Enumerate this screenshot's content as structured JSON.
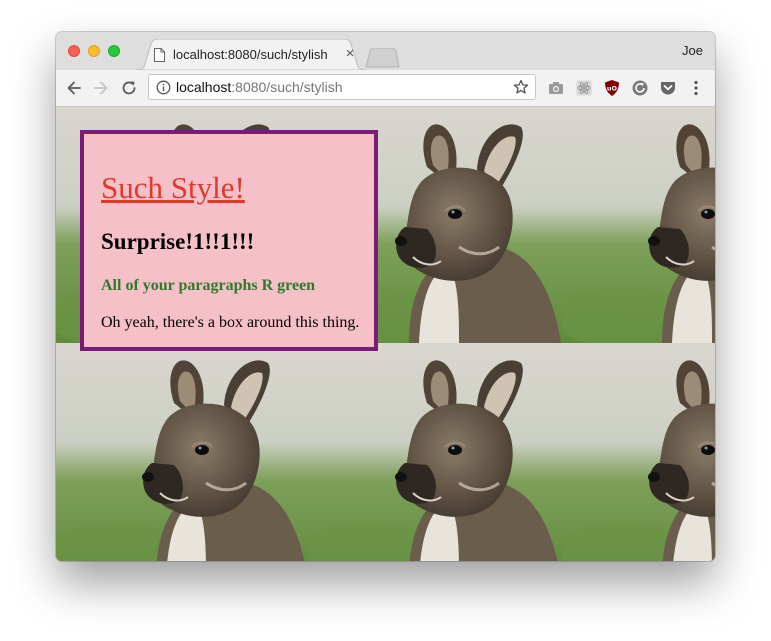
{
  "browser": {
    "tab": {
      "title": "localhost:8080/such/stylish"
    },
    "profile_name": "Joe",
    "omnibox": {
      "host": "localhost",
      "path": ":8080/such/stylish"
    }
  },
  "page": {
    "heading": "Such Style!",
    "subheading": "Surprise!1!!1!!!",
    "green_paragraph": "All of your paragraphs R green",
    "plain_paragraph": "Oh yeah, there's a box around this thing.",
    "colors": {
      "box_background": "#f6c0c9",
      "box_border": "#7b1a78",
      "heading": "#e0392b",
      "green_text": "#2f7a2a"
    },
    "background_image": "wallaby-photo-tiled"
  }
}
